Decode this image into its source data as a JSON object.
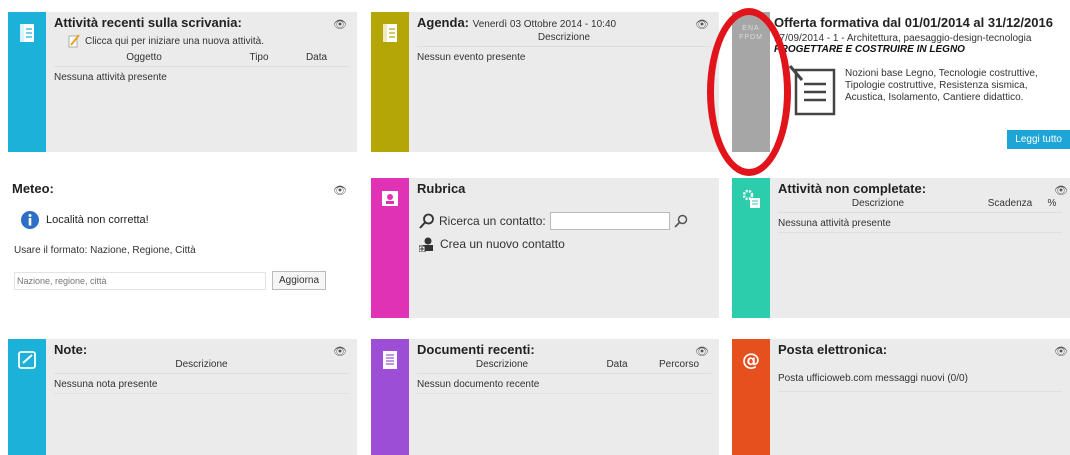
{
  "colors": {
    "cyan": "#1bb1d8",
    "olive": "#b5a607",
    "gray": "#a6a6a6",
    "magenta": "#e032b5",
    "teal": "#2ccdac",
    "purple": "#9c4fd6",
    "orange": "#e6501e",
    "annotation_red": "#e0141a"
  },
  "attivita_recenti": {
    "title": "Attività recenti sulla scrivania:",
    "new_link": "Clicca qui per iniziare una nuova attività.",
    "columns": [
      "Oggetto",
      "Tipo",
      "Data"
    ],
    "empty": "Nessuna attività presente"
  },
  "agenda": {
    "title": "Agenda:",
    "date": "Venerdì 03 Ottobre 2014 - 10:40",
    "column": "Descrizione",
    "empty": "Nessun evento presente"
  },
  "offerta": {
    "title": "Offerta formativa dal 01/01/2014 al 31/12/2016",
    "strip_label": "ENA FPDM",
    "line1": "17/09/2014 - 1 - Architettura, paesaggio-design-tecnologia",
    "line2": "PROGETTARE E COSTRUIRE IN LEGNO",
    "desc": "Nozioni base Legno, Tecnologie costruttive, Tipologie costruttive, Resistenza sismica, Acustica, Isolamento, Cantiere didattico.",
    "read_more": "Leggi tutto"
  },
  "meteo": {
    "title": "Meteo:",
    "error": "Località non corretta!",
    "hint": "Usare il formato: Nazione, Regione, Città",
    "input_placeholder": "Nazione, regione, città",
    "button": "Aggiorna"
  },
  "rubrica": {
    "title": "Rubrica",
    "search_label": "Ricerca un contatto:",
    "new_contact": "Crea un nuovo contatto"
  },
  "attivita_non_completate": {
    "title": "Attività non completate:",
    "columns": [
      "Descrizione",
      "Scadenza",
      "%"
    ],
    "empty": "Nessuna attività presente"
  },
  "note": {
    "title": "Note:",
    "column": "Descrizione",
    "empty": "Nessuna nota presente"
  },
  "documenti": {
    "title": "Documenti recenti:",
    "columns": [
      "Descrizione",
      "Data",
      "Percorso"
    ],
    "empty": "Nessun documento recente"
  },
  "posta": {
    "title": "Posta elettronica:",
    "status": "Posta ufficioweb.com messaggi nuovi (0/0)"
  }
}
